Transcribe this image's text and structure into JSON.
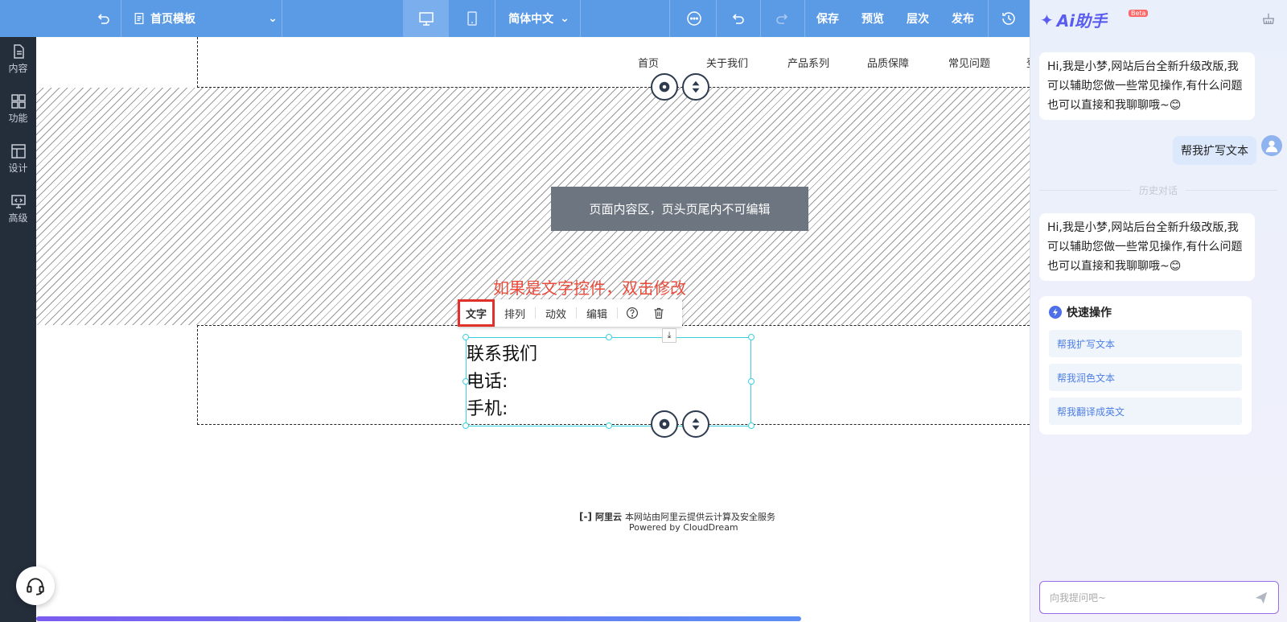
{
  "sidebar": {
    "items": [
      {
        "label": "内容",
        "icon": "document-icon"
      },
      {
        "label": "功能",
        "icon": "grid-icon"
      },
      {
        "label": "设计",
        "icon": "layout-icon"
      },
      {
        "label": "高级",
        "icon": "code-monitor-icon"
      }
    ]
  },
  "toolbar": {
    "page_select": "首页模板",
    "language": "简体中文",
    "save": "保存",
    "preview": "预览",
    "layers": "层次",
    "publish": "发布"
  },
  "site_nav": [
    "首页",
    "关于我们",
    "产品系列",
    "品质保障",
    "常见问题",
    "登"
  ],
  "canvas": {
    "placeholder": "页面内容区，页头页尾内不可编辑",
    "hint": "如果是文字控件，双击修改",
    "control_toolbar": [
      "文字",
      "排列",
      "动效",
      "编辑"
    ],
    "text_lines": [
      "联系我们",
      "电话:",
      "手机:"
    ],
    "footer_brand": "阿里云",
    "footer_line1": "本网站由阿里云提供云计算及安全服务",
    "footer_line2": "Powered by CloudDream",
    "progress_percent": 77
  },
  "ai": {
    "title": "Ai助手",
    "beta": "Beta",
    "greeting": "Hi,我是小梦,网站后台全新升级改版,我可以辅助您做一些常见操作,有什么问题也可以直接和我聊聊哦~😊",
    "user_message": "帮我扩写文本",
    "history_label": "历史对话",
    "quick_title": "快速操作",
    "quick_actions": [
      "帮我扩写文本",
      "帮我润色文本",
      "帮我翻译成英文"
    ],
    "input_placeholder": "向我提问吧~"
  },
  "colors": {
    "toolbar": "#5b9be6",
    "sidebar": "#242d3a",
    "accent": "#5a5cf0",
    "hint": "#e94b3c"
  }
}
